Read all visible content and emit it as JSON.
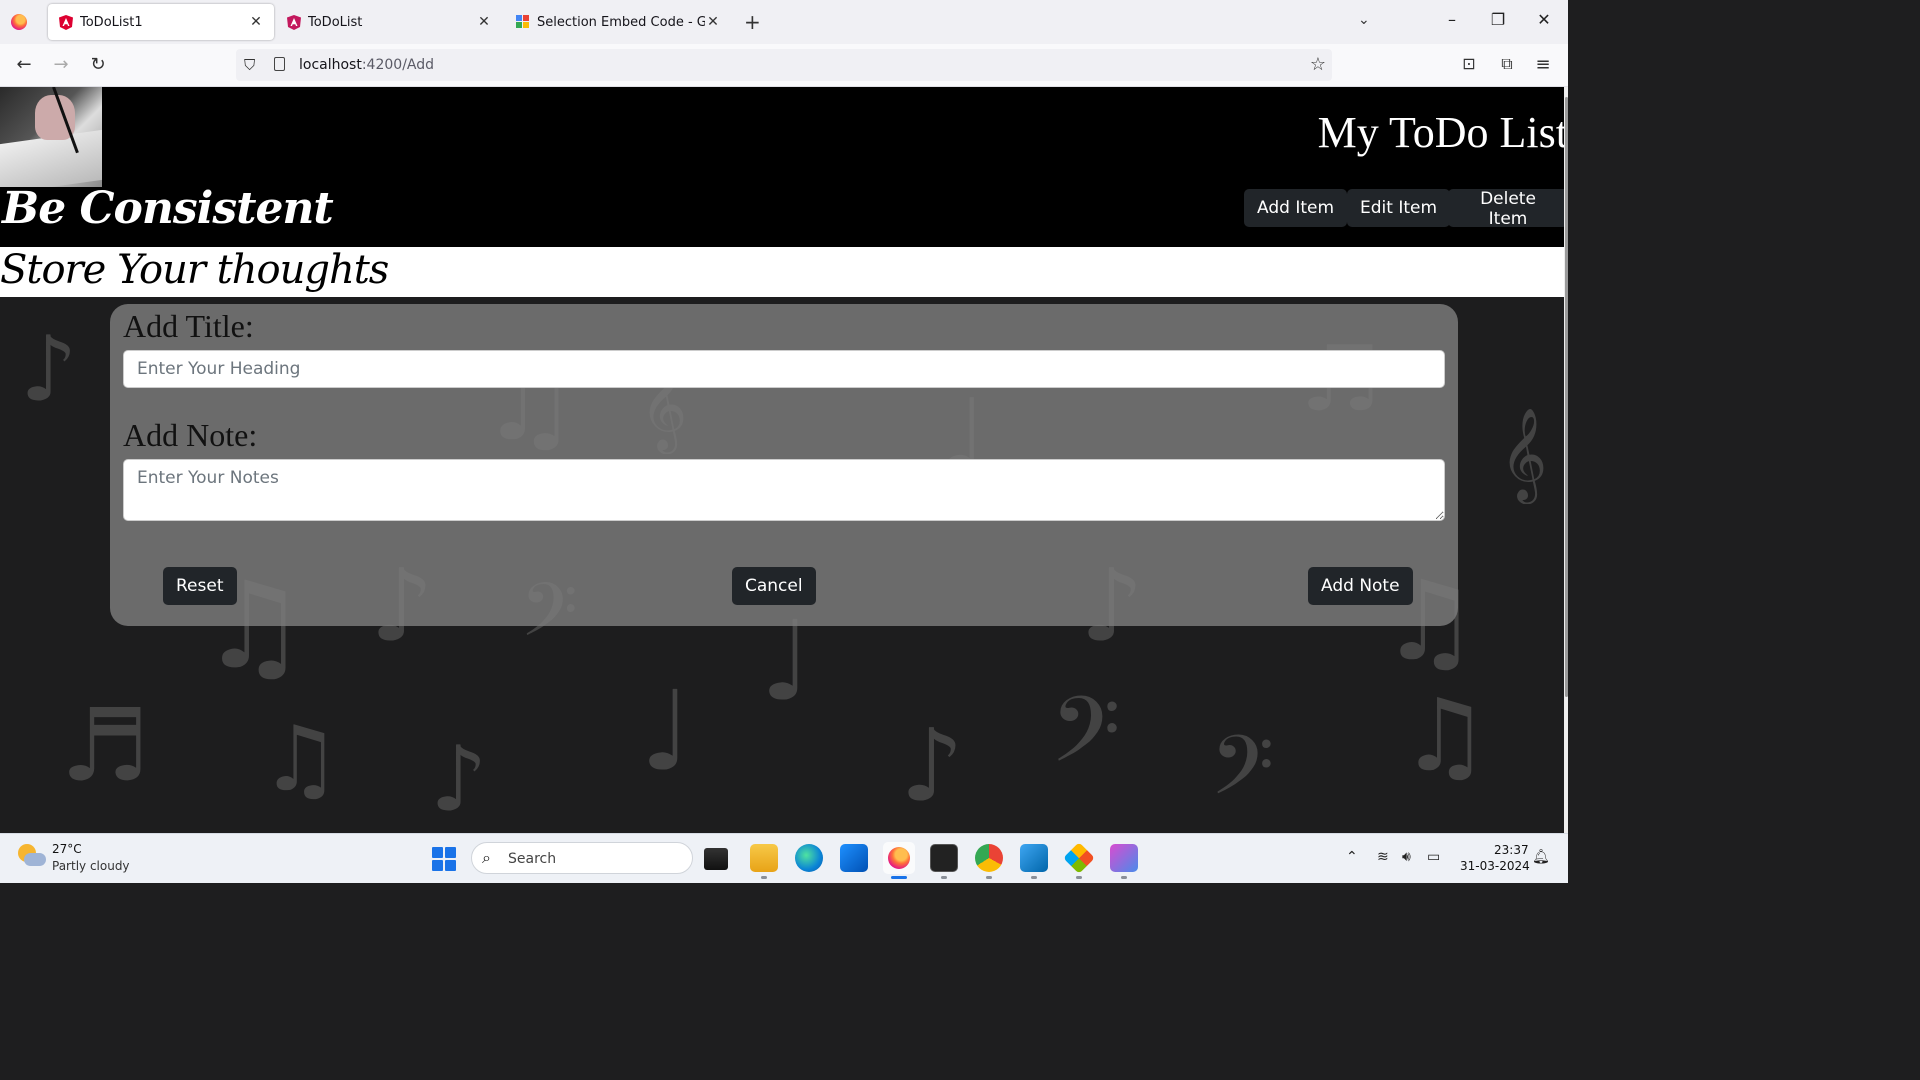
{
  "browser": {
    "tabs": [
      {
        "title": "ToDoList1",
        "active": true
      },
      {
        "title": "ToDoList",
        "active": false
      },
      {
        "title": "Selection Embed Code - Googl",
        "active": false
      }
    ],
    "url_host": "localhost",
    "url_path": ":4200/Add"
  },
  "header": {
    "tagline": "Be Consistent",
    "brand": "My ToDo List",
    "nav": [
      "Add Item",
      "Edit Item",
      "Delete Item"
    ]
  },
  "subtitle": "Store Your thoughts",
  "form": {
    "title_label": "Add Title:",
    "title_placeholder": "Enter Your Heading",
    "note_label": "Add Note:",
    "note_placeholder": "Enter Your Notes",
    "reset_label": "Reset",
    "cancel_label": "Cancel",
    "submit_label": "Add Note"
  },
  "taskbar": {
    "weather_temp": "27°C",
    "weather_desc": "Partly cloudy",
    "search_label": "Search",
    "time": "23:37",
    "date": "31-03-2024"
  },
  "colors": {
    "header_bg": "#000000",
    "button_bg": "#212529",
    "card_bg": "#7d7d7d",
    "page_bg": "#1d1d1e"
  }
}
